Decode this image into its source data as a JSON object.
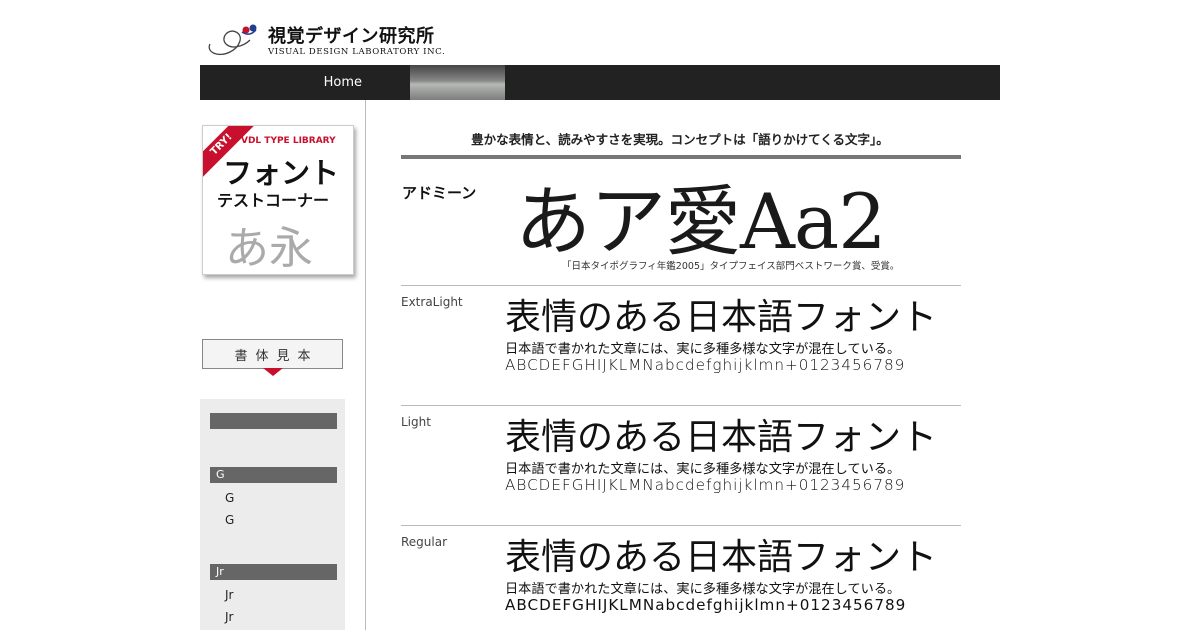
{
  "header": {
    "logo_jp": "視覚デザイン研究所",
    "logo_en": "VISUAL DESIGN LABORATORY INC."
  },
  "nav": {
    "home_label": "Home"
  },
  "banner": {
    "try_label": "TRY!",
    "library_label": "VDL TYPE LIBRARY",
    "title_line1": "フォント",
    "title_line2": "テストコーナー",
    "sample_chars": "あ永"
  },
  "sidebar": {
    "specimen_label": "書体見本",
    "categories": [
      {
        "label": "",
        "items": []
      },
      {
        "label": "G",
        "items": [
          "G",
          "G"
        ]
      },
      {
        "label": "Jr",
        "items": [
          "Jr",
          "Jr"
        ]
      }
    ]
  },
  "main": {
    "tagline": "豊かな表情と、読みやすさを実現。コンセプトは「語りかけてくる文字」。",
    "font_name": "アドミーン",
    "hero_sample": "あア愛Aa2",
    "award": "「日本タイポグラフィ年鑑2005」タイプフェイス部門ベストワーク賞、受賞。",
    "weights": [
      {
        "label": "ExtraLight",
        "heading": "表情のある日本語フォント",
        "sentence": "日本語で書かれた文章には、実に多種多様な文字が混在している。",
        "alphabet": "ABCDEFGHIJKLMNabcdefghijklmn+0123456789"
      },
      {
        "label": "Light",
        "heading": "表情のある日本語フォント",
        "sentence": "日本語で書かれた文章には、実に多種多様な文字が混在している。",
        "alphabet": "ABCDEFGHIJKLMNabcdefghijklmn+0123456789"
      },
      {
        "label": "Regular",
        "heading": "表情のある日本語フォント",
        "sentence": "日本語で書かれた文章には、実に多種多様な文字が混在している。",
        "alphabet": "ABCDEFGHIJKLMNabcdefghijklmn+0123456789"
      }
    ]
  },
  "colors": {
    "nav_bg": "#222222",
    "accent_red": "#c8102e",
    "sidebar_bg": "#ececec",
    "category_bar": "#666666"
  }
}
